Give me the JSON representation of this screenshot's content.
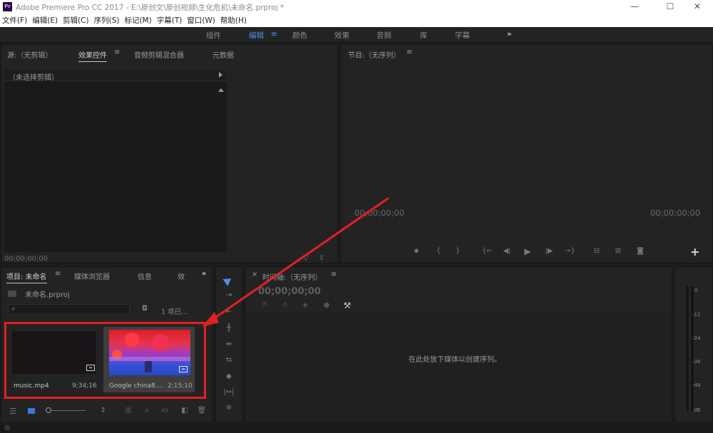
{
  "titlebar": {
    "app_icon": "Pr",
    "title": "Adobe Premiere Pro CC 2017 - E:\\原创文\\原创视频\\生化危机\\未命名.prproj *",
    "minimize": "—",
    "maximize": "☐",
    "close": "✕"
  },
  "menu": [
    "文件(F)",
    "编辑(E)",
    "剪辑(C)",
    "序列(S)",
    "标记(M)",
    "字幕(T)",
    "窗口(W)",
    "帮助(H)"
  ],
  "workspaces": {
    "items": [
      "组件",
      "编辑",
      "颜色",
      "效果",
      "音频",
      "库",
      "字幕"
    ],
    "active": "编辑",
    "menu_icon": "≡",
    "more": "»"
  },
  "source_panel": {
    "tabs": [
      "源:（无剪辑）",
      "效果控件",
      "音频剪辑混合器",
      "元数据"
    ],
    "active_tab": "效果控件",
    "menu_icon": "≡",
    "no_clip": "（未选择剪辑）",
    "timecode": "00;00;00;00"
  },
  "program_panel": {
    "title": "节目:（无序列）",
    "menu_icon": "≡",
    "timecode_left": "00;00;00;00",
    "timecode_right": "00;00;00;00",
    "add": "+"
  },
  "project_panel": {
    "tabs": [
      "项目: 未命名",
      "媒体浏览器",
      "信息",
      "效"
    ],
    "active_tab": "项目: 未命名",
    "menu_icon": "≡",
    "more": "»",
    "project_file": "未命名.prproj",
    "search_placeholder": "",
    "items_selected": "1 项已...",
    "items": [
      {
        "name": "music.mp4",
        "duration": "9;34;16"
      },
      {
        "name": "Google china8....",
        "duration": "2;15;10"
      }
    ]
  },
  "timeline_panel": {
    "close": "×",
    "title": "时间轴:（无序列）",
    "menu_icon": "≡",
    "timecode": "00;00;00;00",
    "empty_message": "在此处放下媒体以创建序列。"
  },
  "audio_meter": {
    "ticks": [
      "0",
      "-12",
      "-24",
      "-36",
      "-48",
      "dB"
    ]
  },
  "colors": {
    "accent": "#4a8fe8",
    "highlight": "#e32020",
    "panel": "#232323"
  }
}
